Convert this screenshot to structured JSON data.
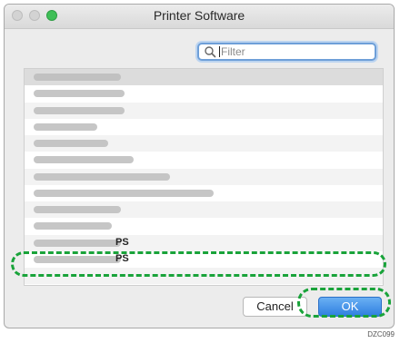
{
  "window": {
    "title": "Printer Software"
  },
  "search": {
    "placeholder": "Filter",
    "value": ""
  },
  "list": {
    "header_label": "",
    "rows": [
      {
        "label": "",
        "suffix": ""
      },
      {
        "label": "",
        "suffix": ""
      },
      {
        "label": "",
        "suffix": ""
      },
      {
        "label": "",
        "suffix": ""
      },
      {
        "label": "",
        "suffix": ""
      },
      {
        "label": "",
        "suffix": ""
      },
      {
        "label": "",
        "suffix": ""
      },
      {
        "label": "",
        "suffix": ""
      },
      {
        "label": "",
        "suffix": ""
      },
      {
        "label": "",
        "suffix": ""
      },
      {
        "label": "",
        "suffix": "PS"
      },
      {
        "label": "",
        "suffix": "PS",
        "selected": true
      }
    ]
  },
  "buttons": {
    "cancel": "Cancel",
    "ok": "OK"
  },
  "figure_code": "DZC099",
  "colors": {
    "highlight": "#19a33a",
    "ok_button": "#2f7fe0",
    "zoom_light": "#3fbf57"
  }
}
